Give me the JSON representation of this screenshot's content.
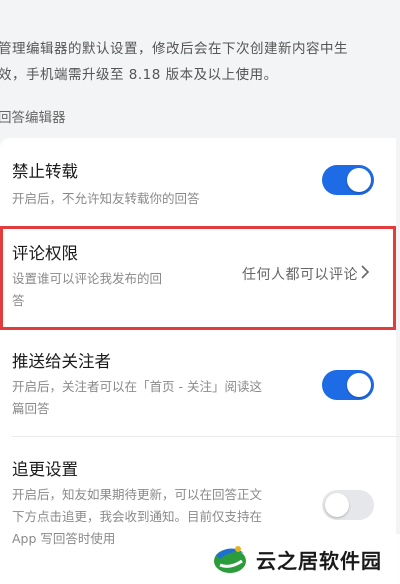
{
  "intro": {
    "line1": "管理编辑器的默认设置，修改后会在下次创建新内容中生",
    "line2": "效，手机端需升级至 8.18 版本及以上使用。"
  },
  "section_label": "回答编辑器",
  "settings": {
    "no_repost": {
      "title": "禁止转载",
      "desc": "开启后，不允许知友转载你的回答",
      "enabled": true
    },
    "comment_permission": {
      "title": "评论权限",
      "desc_line1": "设置谁可以评论我发布的回",
      "desc_line2": "答",
      "value": "任何人都可以评论",
      "chevron": "chevron-right-icon"
    },
    "push_to_followers": {
      "title": "推送给关注者",
      "desc_line1": "开启后，关注者可以在「首页 - 关注」阅读这",
      "desc_line2": "篇回答",
      "enabled": true
    },
    "follow_up": {
      "title": "追更设置",
      "desc_line1": "开启后，知友如果期待更新，可以在回答正文",
      "desc_line2": "下方点击追更，我会收到通知。目前仅支持在",
      "desc_line3": "App 写回答时使用",
      "enabled": false
    }
  },
  "colors": {
    "toggle_on": "#1e6be6",
    "toggle_off": "#e6e7ea",
    "highlight_border": "#e23c3c"
  },
  "watermark": {
    "text": "云之居软件园",
    "logo": "yunzhiju-logo"
  }
}
